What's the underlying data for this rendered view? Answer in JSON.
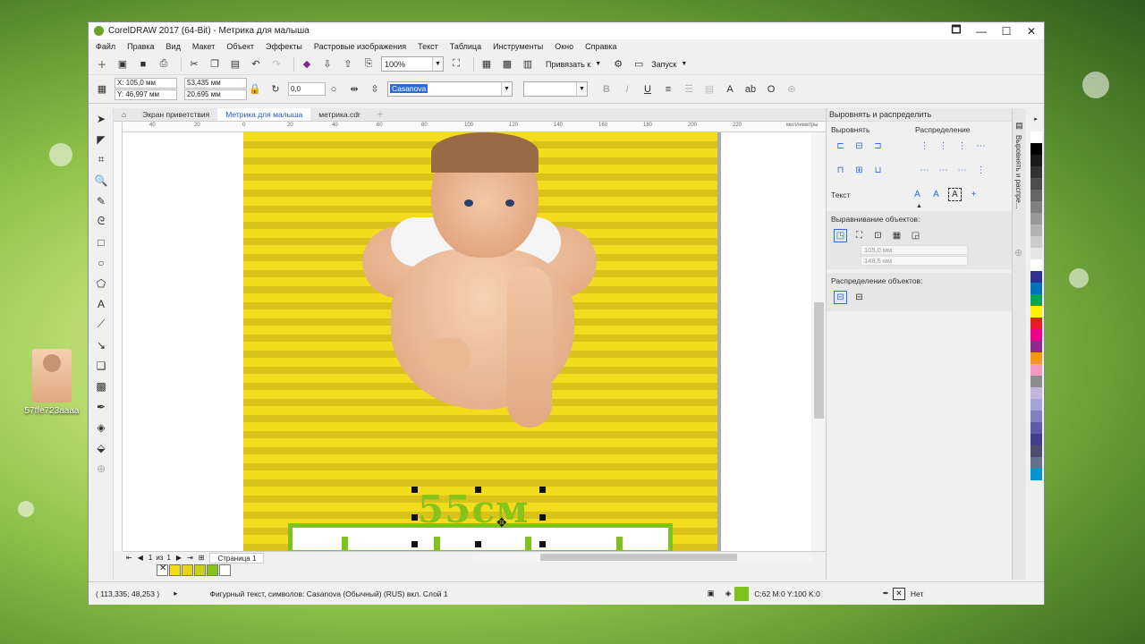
{
  "window": {
    "title": "CorelDRAW 2017 (64-Bit) - Метрика для малыша",
    "buttons": [
      "🗖",
      "—",
      "☐",
      "✕"
    ]
  },
  "desktop": {
    "icon_label": "57ffe723aaaa"
  },
  "menu": [
    "Файл",
    "Правка",
    "Вид",
    "Макет",
    "Объект",
    "Эффекты",
    "Растровые изображения",
    "Текст",
    "Таблица",
    "Инструменты",
    "Окно",
    "Справка"
  ],
  "toolbar": {
    "zoom": "100%",
    "snap_label": "Привязать к",
    "launch_label": "Запуск"
  },
  "propbar": {
    "x": "X: 105,0 мм",
    "y": "Y: 46,997 мм",
    "w": "53,435 мм",
    "h": "20,695 мм",
    "angle": "0,0",
    "font": "Casanova"
  },
  "tabs": [
    "Экран приветствия",
    "Метрика для малыша",
    "метрика.cdr"
  ],
  "ruler": {
    "labels": [
      "40",
      "20",
      "0",
      "20",
      "40",
      "60",
      "80",
      "100",
      "120",
      "140",
      "160",
      "180",
      "200",
      "220"
    ],
    "unit": "миллиметры"
  },
  "canvas": {
    "artistic_text": "55см"
  },
  "pagebar": {
    "current": "1",
    "of": "из",
    "total": "1",
    "page_tab": "Страница 1"
  },
  "status": {
    "coords": "( 113,335; 48,253 )",
    "info": "Фигурный текст, символов: Casanova (Обычный) (RUS) вкл. Слой 1",
    "fill": "C:62 M:0 Y:100 K:0",
    "outline": "Нет"
  },
  "docker": {
    "title": "Выровнять и распределить",
    "align_label": "Выровнять",
    "distribute_label": "Распределение",
    "text_label": "Текст",
    "align_objects_label": "Выравнивание объектов:",
    "x_field": "105,0 мм",
    "y_field": "148,5 мм",
    "distribute_objects_label": "Распределение объектов:",
    "vertical_tab": "Выровнять и распре..."
  },
  "colors": {
    "page_yellow": "#f2dc1d",
    "text_green": "#86c31b",
    "accent_blue": "#2d6bd6"
  },
  "palette": [
    "#ffffff",
    "#000000",
    "#1a1a1a",
    "#333333",
    "#4d4d4d",
    "#666666",
    "#808080",
    "#999999",
    "#b3b3b3",
    "#cccccc",
    "#e6e6e6",
    "#ffffff",
    "#2e3192",
    "#0072bc",
    "#00a651",
    "#fff200",
    "#ed1c24",
    "#ec008c",
    "#92278f",
    "#f7941d",
    "#f49ac1",
    "#8c8c8c",
    "#c2b5e0",
    "#a3a3d6",
    "#8080c0",
    "#5c5ca8",
    "#3f3f8c",
    "#4d4d70",
    "#66708c",
    "#0096d6"
  ],
  "doc_palette": [
    "#f2dc1d",
    "#e8d21a",
    "#c6d21b",
    "#86c31b",
    "#ffffff"
  ]
}
